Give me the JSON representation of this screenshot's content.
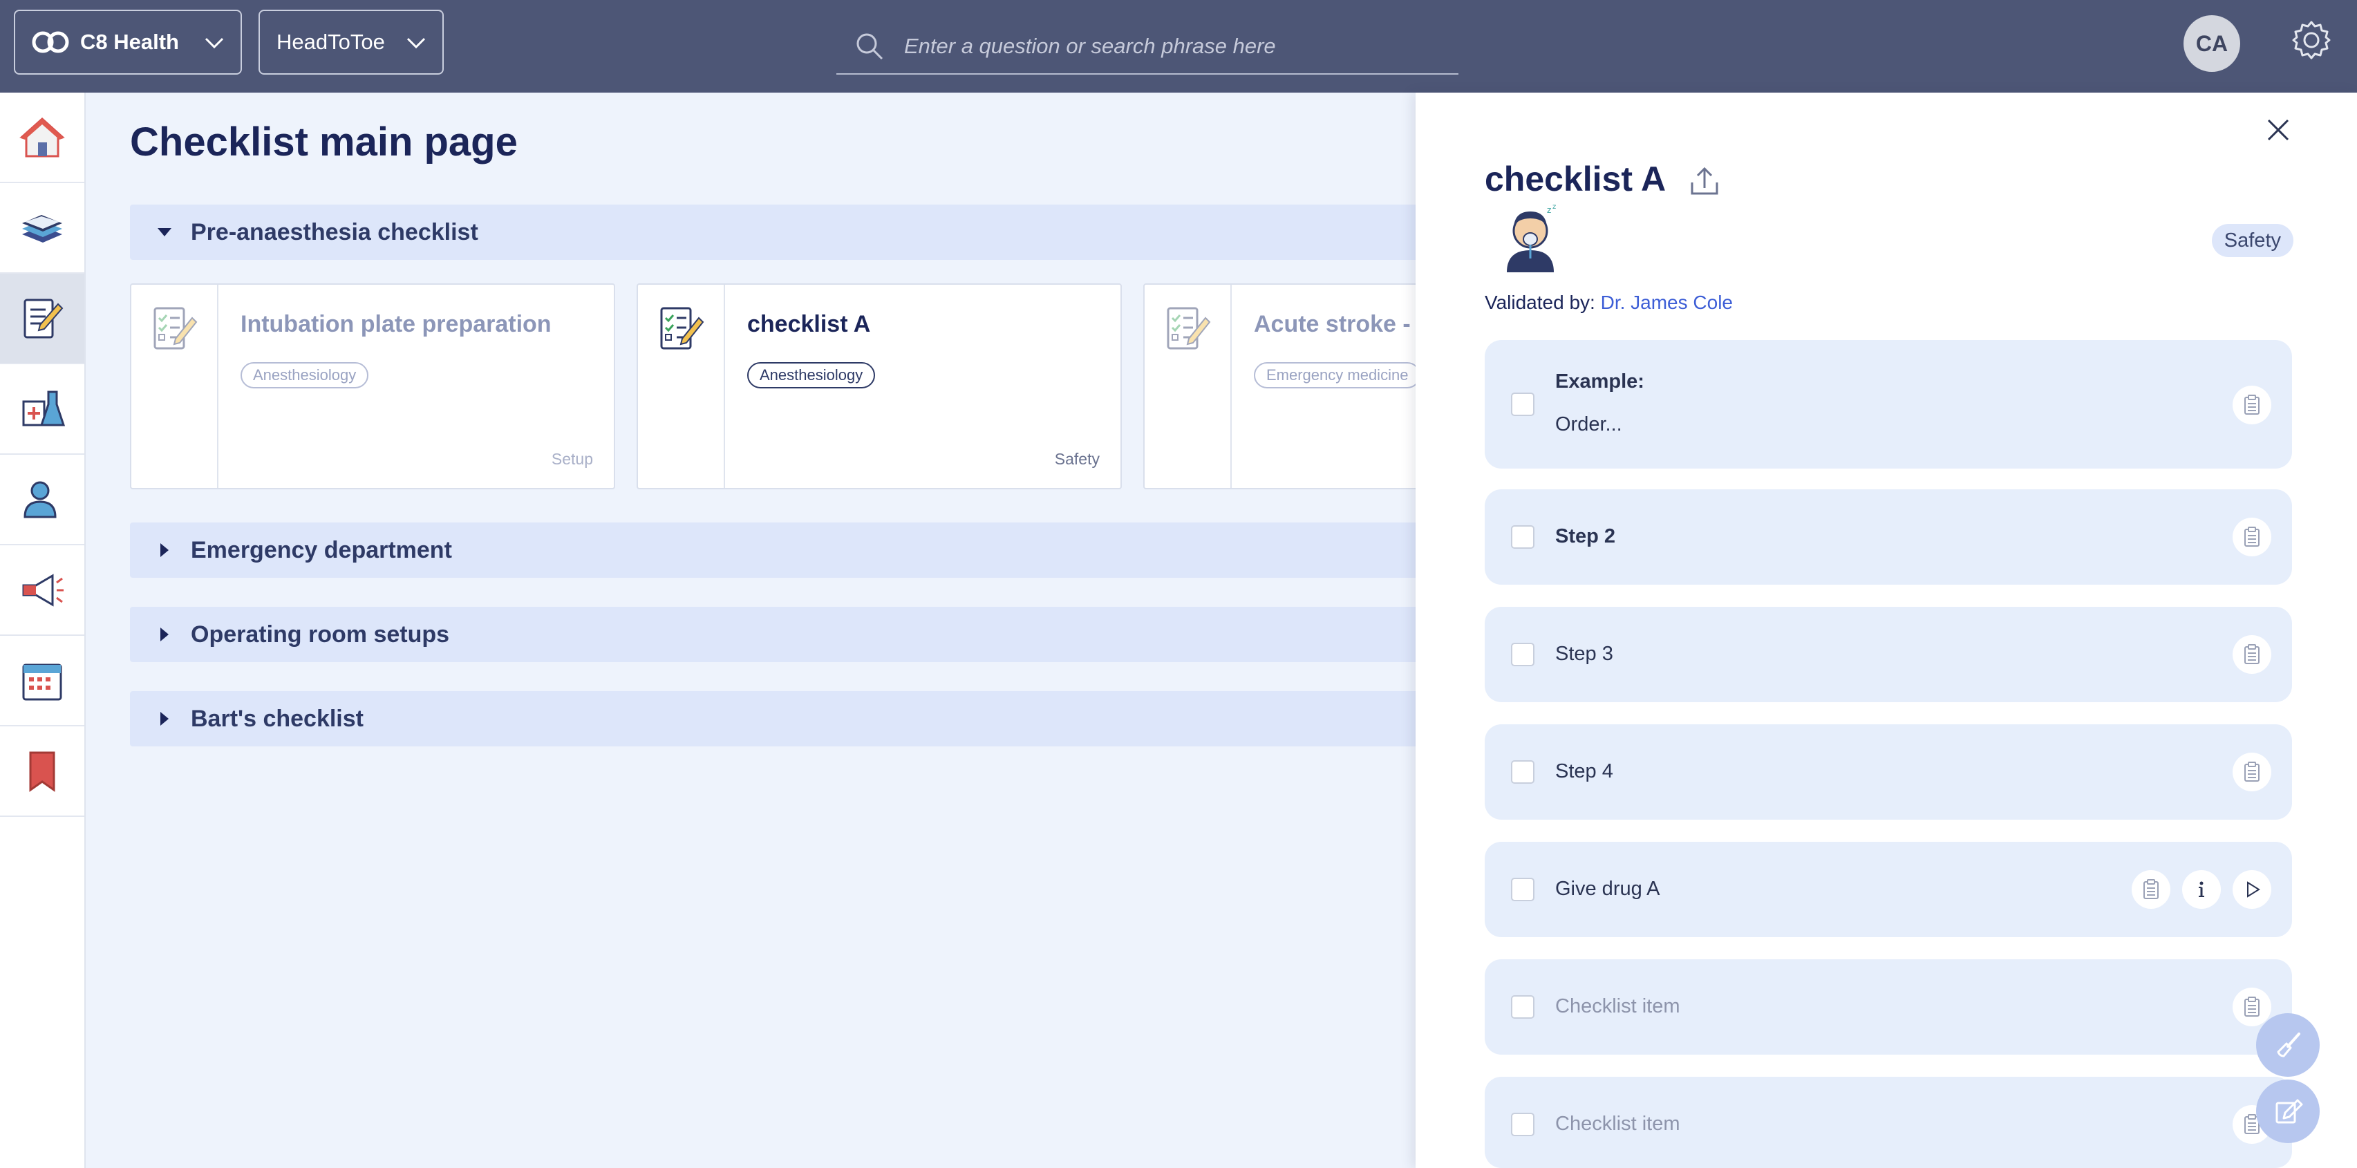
{
  "topbar": {
    "org_name": "C8 Health",
    "workspace": "HeadToToe",
    "search_placeholder": "Enter a question or search phrase here",
    "user_initials": "CA"
  },
  "sidebar": {
    "items": [
      {
        "name": "home-icon"
      },
      {
        "name": "books-icon"
      },
      {
        "name": "checklist-icon",
        "active": true
      },
      {
        "name": "lab-icon"
      },
      {
        "name": "people-icon"
      },
      {
        "name": "megaphone-icon"
      },
      {
        "name": "calendar-icon"
      },
      {
        "name": "bookmark-icon"
      }
    ]
  },
  "main": {
    "title": "Checklist main page",
    "sections": [
      {
        "label": "Pre-anaesthesia checklist",
        "expanded": true
      },
      {
        "label": "Emergency department",
        "expanded": false
      },
      {
        "label": "Operating room setups",
        "expanded": false
      },
      {
        "label": "Bart's checklist",
        "expanded": false
      }
    ],
    "cards": [
      {
        "title": "Intubation plate preparation",
        "tag": "Anesthesiology",
        "category": "Setup"
      },
      {
        "title": "checklist A",
        "tag": "Anesthesiology",
        "category": "Safety"
      },
      {
        "title": "Acute stroke - c",
        "tag": "Emergency medicine",
        "category": ""
      }
    ]
  },
  "panel": {
    "title": "checklist A",
    "badge": "Safety",
    "validated_label": "Validated by:",
    "validator": "Dr. James Cole",
    "steps": [
      {
        "title": "Example:",
        "subtitle": "Order..."
      },
      {
        "title": "Step 2"
      },
      {
        "title": "Step 3"
      },
      {
        "title": "Step 4"
      },
      {
        "title": "Give drug A"
      },
      {
        "title": "Checklist item"
      },
      {
        "title": "Checklist item"
      }
    ]
  },
  "colors": {
    "topbar": "#4d5676",
    "accent": "#1b2559",
    "link": "#3d5ed6",
    "section_bg": "#dde6fa",
    "step_bg": "#e6eefb"
  }
}
